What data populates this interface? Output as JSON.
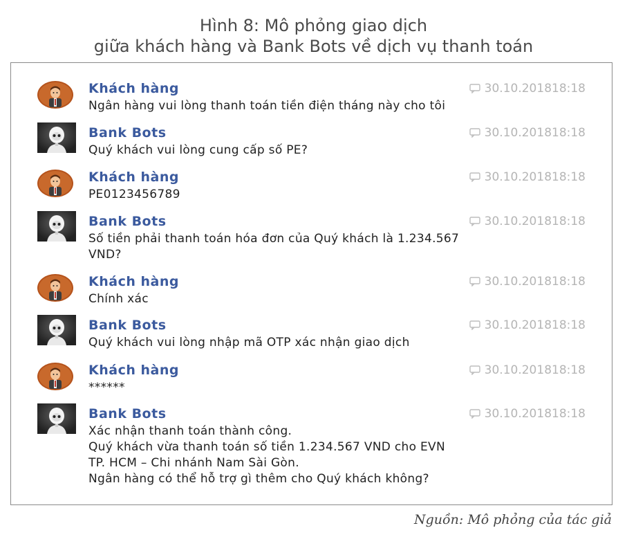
{
  "figure": {
    "title_line1": "Hình 8: Mô phỏng giao dịch",
    "title_line2": "giữa khách hàng và Bank Bots về dịch vụ thanh toán",
    "source": "Nguồn: Mô phỏng của tác giả"
  },
  "chat": {
    "messages": [
      {
        "sender": "Khách hàng",
        "role": "customer",
        "time": "30.10.201818:18",
        "lines": [
          "Ngân hàng vui lòng thanh toán tiền điện tháng này cho tôi"
        ]
      },
      {
        "sender": "Bank Bots",
        "role": "bot",
        "time": "30.10.201818:18",
        "lines": [
          "Quý khách vui lòng cung cấp số PE?"
        ]
      },
      {
        "sender": "Khách hàng",
        "role": "customer",
        "time": "30.10.201818:18",
        "lines": [
          "PE0123456789"
        ]
      },
      {
        "sender": "Bank Bots",
        "role": "bot",
        "time": "30.10.201818:18",
        "lines": [
          "Số tiền phải thanh toán hóa đơn của Quý khách là 1.234.567",
          "VND?"
        ]
      },
      {
        "sender": "Khách hàng",
        "role": "customer",
        "time": "30.10.201818:18",
        "lines": [
          "Chính xác"
        ]
      },
      {
        "sender": "Bank Bots",
        "role": "bot",
        "time": "30.10.201818:18",
        "lines": [
          "Quý khách vui lòng nhập mã OTP xác nhận giao dịch"
        ]
      },
      {
        "sender": "Khách hàng",
        "role": "customer",
        "time": "30.10.201818:18",
        "lines": [
          "******"
        ]
      },
      {
        "sender": "Bank Bots",
        "role": "bot",
        "time": "30.10.201818:18",
        "lines": [
          "Xác nhận thanh toán thành công.",
          "Quý khách vừa thanh toán số tiền 1.234.567 VND cho EVN",
          "TP. HCM – Chi nhánh Nam Sài Gòn.",
          "Ngân hàng có thể hỗ trợ gì thêm cho Quý khách không?"
        ]
      }
    ]
  },
  "colors": {
    "sender_name": "#3b5a9e",
    "timestamp": "#b5b5b5",
    "customer_avatar": "#b5531c",
    "bot_avatar": "#3a3a3a"
  },
  "icons": {
    "timestamp": "speech-bubble-icon",
    "customer": "person-avatar-icon",
    "bot": "robot-avatar-icon"
  }
}
